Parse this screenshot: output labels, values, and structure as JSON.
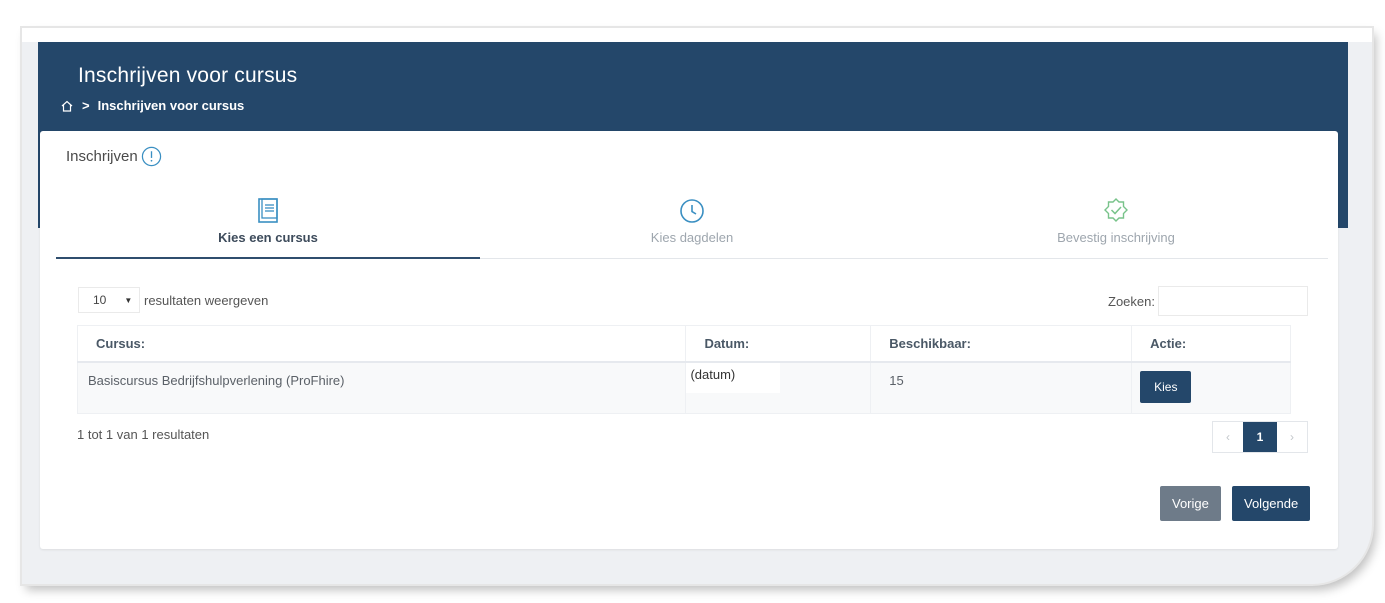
{
  "header": {
    "title": "Inschrijven voor cursus",
    "breadcrumb_current": "Inschrijven voor cursus",
    "breadcrumb_separator": ">"
  },
  "card": {
    "title": "Inschrijven"
  },
  "steps": [
    {
      "label": "Kies een cursus",
      "icon": "book-icon",
      "state": "active"
    },
    {
      "label": "Kies dagdelen",
      "icon": "clock-icon",
      "state": "inactive"
    },
    {
      "label": "Bevestig inschrijving",
      "icon": "check-badge-icon",
      "state": "inactive"
    }
  ],
  "table_controls": {
    "length_value": "10",
    "length_suffix": "resultaten weergeven",
    "search_label": "Zoeken:",
    "search_value": ""
  },
  "table": {
    "columns": [
      "Cursus:",
      "Datum:",
      "Beschikbaar:",
      "Actie:"
    ],
    "rows": [
      {
        "cursus": "Basiscursus Bedrijfshulpverlening (ProFhire)",
        "datum": "(datum)",
        "beschikbaar": "15",
        "actie": "Kies"
      }
    ]
  },
  "pagination": {
    "info": "1 tot 1 van 1 resultaten",
    "prev": "‹",
    "current": "1",
    "next": "›"
  },
  "wizard_buttons": {
    "prev": "Vorige",
    "next": "Volgende"
  },
  "colors": {
    "header_bg": "#24476a",
    "primary_button": "#24476a",
    "secondary_button": "#6e7b89",
    "active_step_icon": "#3a8fc2",
    "info_icon": "#3a8fc2",
    "confirm_icon": "#78c38a"
  }
}
